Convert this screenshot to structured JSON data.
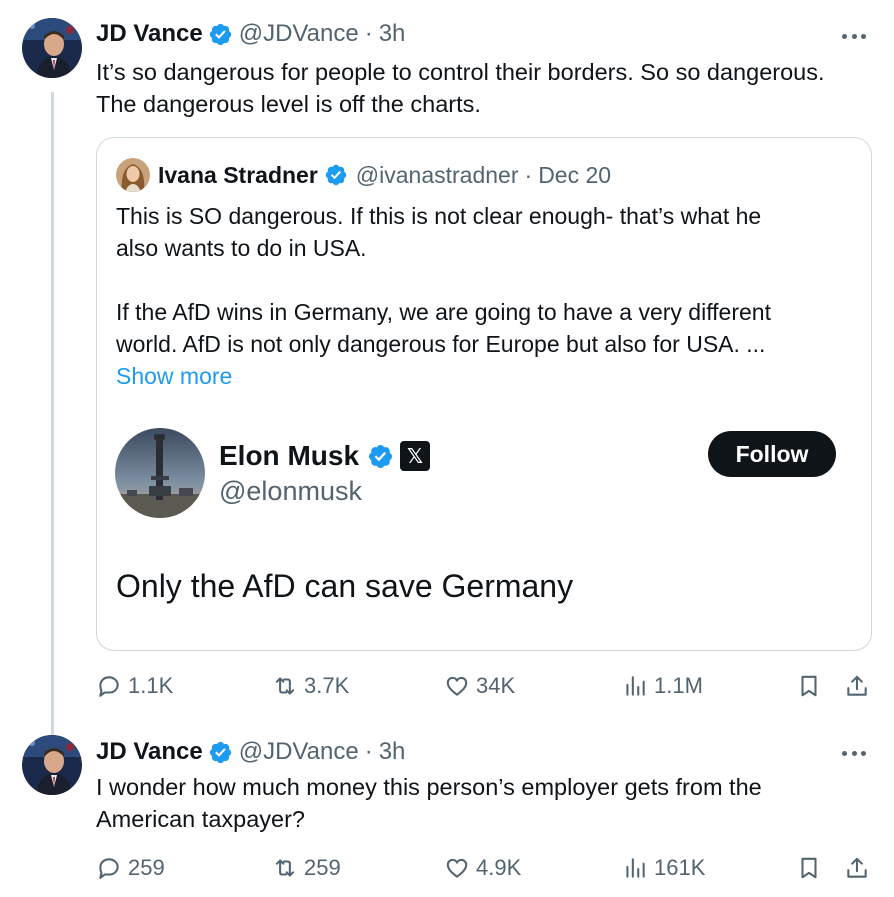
{
  "tweets": [
    {
      "author": {
        "name": "JD Vance",
        "handle": "@JDVance",
        "time": "3h",
        "verified": true
      },
      "text_lines": [
        "It’s so dangerous for people to control their borders. So so dangerous.",
        "The dangerous level is off the charts."
      ],
      "quote": {
        "author": {
          "name": "Ivana Stradner",
          "handle": "@ivanastradner",
          "time": "Dec 20",
          "verified": true
        },
        "text_lines_1": [
          "This is SO dangerous. If this is not clear enough- that’s what he",
          "also wants to do in USA."
        ],
        "text_lines_2": [
          "If the AfD wins in Germany, we are going to have a very different",
          "world. AfD is not only dangerous for Europe but also for USA. ..."
        ],
        "show_more": "Show more",
        "embedded": {
          "name": "Elon Musk",
          "handle": "@elonmusk",
          "follow_label": "Follow",
          "x_badge": "𝕏",
          "text": "Only the AfD can save Germany"
        }
      },
      "stats": {
        "replies": "1.1K",
        "reposts": "3.7K",
        "likes": "34K",
        "views": "1.1M"
      }
    },
    {
      "author": {
        "name": "JD Vance",
        "handle": "@JDVance",
        "time": "3h",
        "verified": true
      },
      "text_lines": [
        "I wonder how much money this person’s employer gets from the",
        "American taxpayer?"
      ],
      "stats": {
        "replies": "259",
        "reposts": "259",
        "likes": "4.9K",
        "views": "161K"
      }
    }
  ],
  "colors": {
    "text": "#0f1419",
    "secondary": "#536471",
    "link": "#1d9bf0",
    "verified": "#1d9bf0",
    "border": "#cfd9de"
  },
  "icons": [
    "reply-icon",
    "repost-icon",
    "like-icon",
    "views-icon",
    "bookmark-icon",
    "share-icon",
    "verified-badge-icon",
    "more-icon"
  ]
}
